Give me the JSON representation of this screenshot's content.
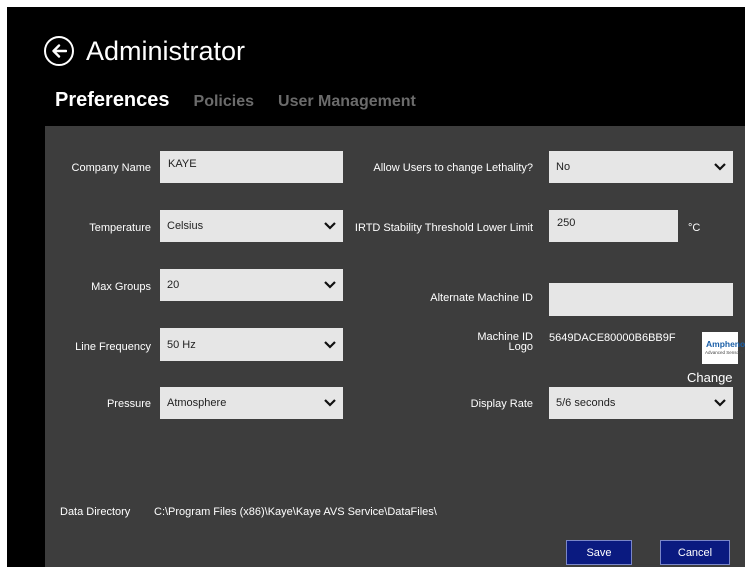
{
  "header": {
    "title": "Administrator"
  },
  "tabs": [
    {
      "label": "Preferences",
      "active": true
    },
    {
      "label": "Policies",
      "active": false
    },
    {
      "label": "User Management",
      "active": false
    }
  ],
  "form": {
    "company_name": {
      "label": "Company Name",
      "value": "KAYE"
    },
    "temperature": {
      "label": "Temperature",
      "value": "Celsius"
    },
    "max_groups": {
      "label": "Max Groups",
      "value": "20"
    },
    "line_frequency": {
      "label": "Line Frequency",
      "value": "50 Hz"
    },
    "pressure": {
      "label": "Pressure",
      "value": "Atmosphere"
    },
    "allow_lethality": {
      "label": "Allow Users to change Lethality?",
      "value": "No"
    },
    "irtd_threshold": {
      "label": "IRTD Stability Threshold Lower Limit",
      "value": "250",
      "unit": "°C"
    },
    "alternate_machine_id": {
      "label": "Alternate Machine ID",
      "value": ""
    },
    "machine_id": {
      "label": "Machine ID",
      "value": "5649DACE80000B6BB9F"
    },
    "logo": {
      "label": "Logo",
      "brand": "Amphenol",
      "sub": "Advanced Sensors",
      "change_label": "Change"
    },
    "display_rate": {
      "label": "Display Rate",
      "value": "5/6 seconds"
    },
    "data_directory": {
      "label": "Data Directory",
      "value": "C:\\Program Files (x86)\\Kaye\\Kaye AVS Service\\DataFiles\\"
    }
  },
  "actions": {
    "save_label": "Save",
    "cancel_label": "Cancel"
  },
  "colors": {
    "panel": "#3d3d3d",
    "field": "#e6e6e6",
    "button": "#0a1a80",
    "logo_brand": "#1a5fa8"
  }
}
